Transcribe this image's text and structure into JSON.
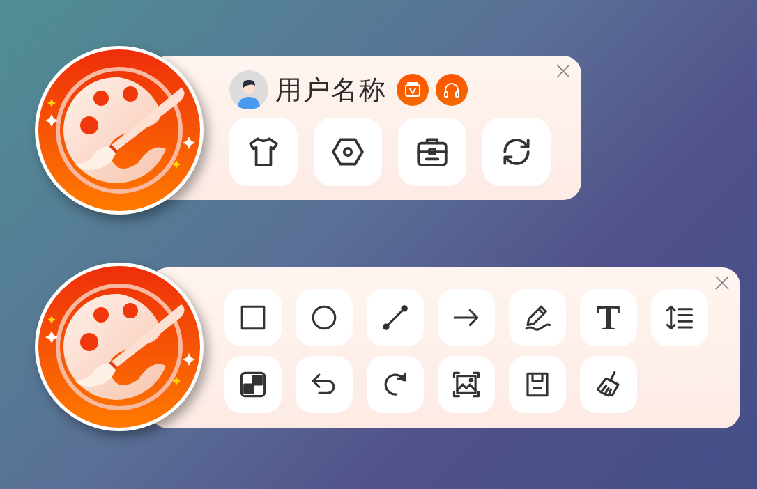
{
  "toolbars": [
    {
      "kind": "profile",
      "user": {
        "name": "用户名称"
      },
      "badges": [
        {
          "kind": "vip"
        },
        {
          "kind": "headset"
        }
      ],
      "rows": [
        [
          {
            "kind": "shirt"
          },
          {
            "kind": "nut"
          },
          {
            "kind": "toolbox"
          },
          {
            "kind": "refresh"
          }
        ]
      ]
    },
    {
      "kind": "drawing",
      "rows": [
        [
          {
            "kind": "rectangle"
          },
          {
            "kind": "circle"
          },
          {
            "kind": "line"
          },
          {
            "kind": "arrow"
          },
          {
            "kind": "pen"
          },
          {
            "kind": "text",
            "label": "T"
          },
          {
            "kind": "spacing"
          }
        ],
        [
          {
            "kind": "mosaic"
          },
          {
            "kind": "undo"
          },
          {
            "kind": "redo"
          },
          {
            "kind": "screenshot"
          },
          {
            "kind": "save"
          },
          {
            "kind": "clear"
          }
        ]
      ]
    }
  ]
}
